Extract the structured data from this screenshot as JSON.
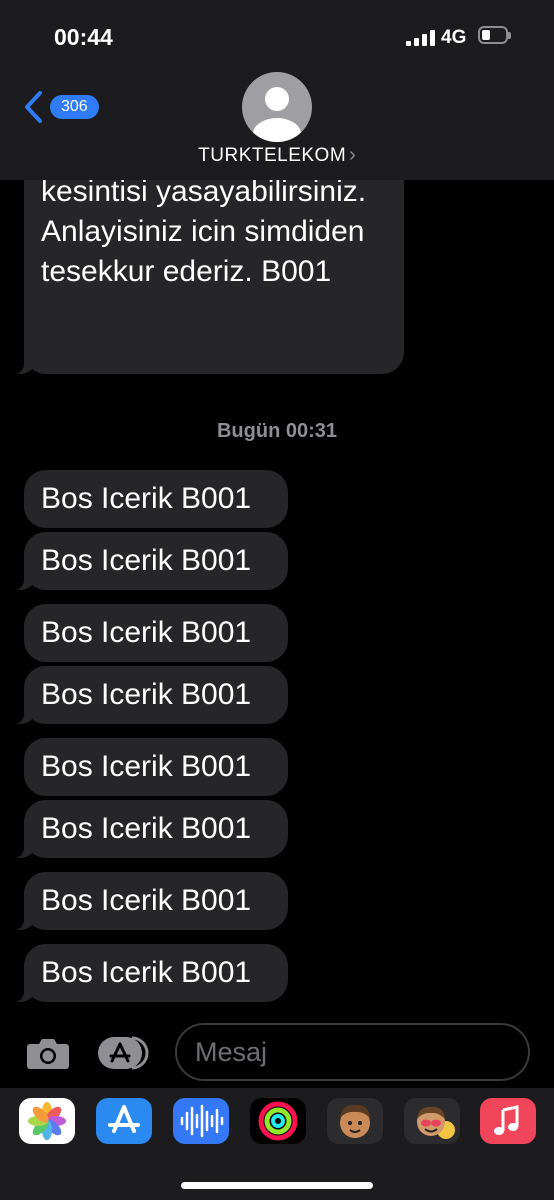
{
  "status": {
    "time": "00:44",
    "network": "4G"
  },
  "header": {
    "back_count": "306",
    "contact_name": "TURKTELEKOM"
  },
  "messages": {
    "long_text": "kesintisi yasayabilirsiniz. Anlayisiniz icin simdiden tesekkur ederiz. B001",
    "timestamp": "Bugün 00:31",
    "short": [
      "Bos Icerik B001",
      "Bos Icerik B001",
      "Bos Icerik B001",
      "Bos Icerik B001",
      "Bos Icerik B001",
      "Bos Icerik B001",
      "Bos Icerik B001",
      "Bos Icerik B001"
    ]
  },
  "composer": {
    "placeholder": "Mesaj"
  },
  "app_drawer": [
    "photos-icon",
    "app-store-icon",
    "audio-message-icon",
    "activity-icon",
    "memoji-icon",
    "memoji-stickers-icon",
    "music-icon"
  ],
  "colors": {
    "accent": "#2f7cf6",
    "bubble": "#262629",
    "header": "#1c1c1e"
  }
}
